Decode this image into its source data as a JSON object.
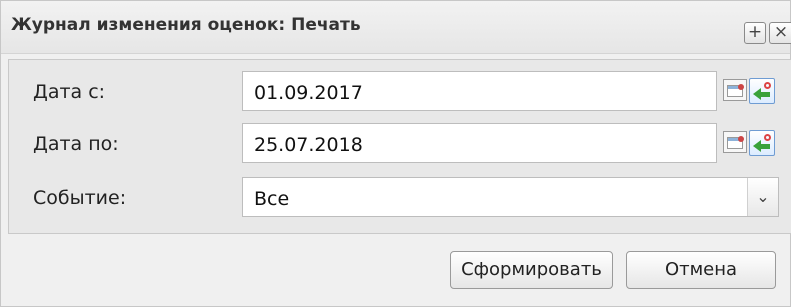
{
  "window": {
    "title": "Журнал изменения оценок: Печать",
    "expand_icon": "+",
    "close_icon": "×"
  },
  "form": {
    "date_from": {
      "label": "Дата с:",
      "value": "01.09.2017"
    },
    "date_to": {
      "label": "Дата по:",
      "value": "25.07.2018"
    },
    "event": {
      "label": "Событие:",
      "value": "Все",
      "dropdown_icon": "⌄"
    }
  },
  "buttons": {
    "generate": "Сформировать",
    "cancel": "Отмена"
  },
  "colors": {
    "accent": "#6f9cd3",
    "reset_arrow": "#3aa23a",
    "reset_ring": "#d44444"
  }
}
